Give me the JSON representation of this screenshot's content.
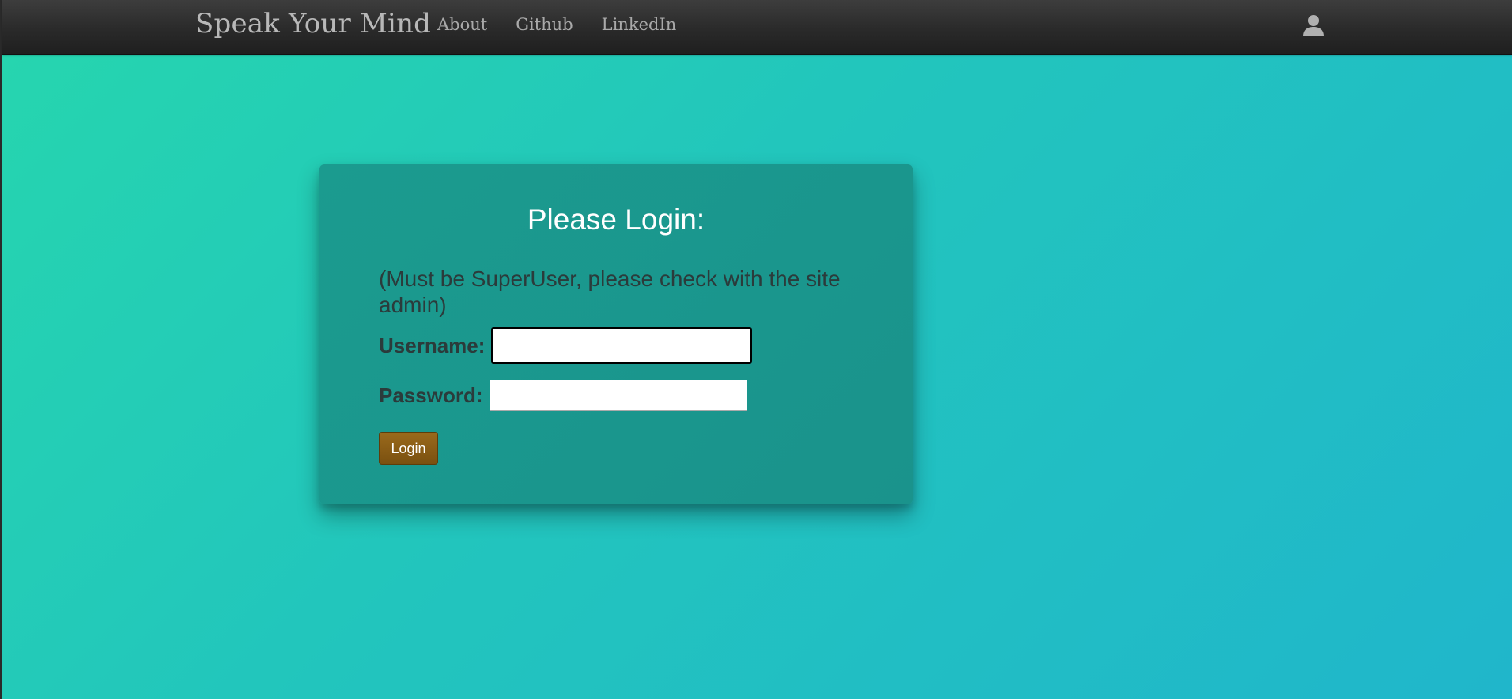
{
  "navbar": {
    "brand": "Speak Your Mind",
    "links": [
      {
        "label": "About"
      },
      {
        "label": "Github"
      },
      {
        "label": "LinkedIn"
      }
    ],
    "user_icon": "user-icon"
  },
  "login": {
    "title": "Please Login:",
    "note": "(Must be SuperUser, please check with the site admin)",
    "username_label": "Username:",
    "username_value": "",
    "password_label": "Password:",
    "password_value": "",
    "submit_label": "Login"
  },
  "colors": {
    "navbar": "#2a2a2a",
    "background_start": "#26d6ae",
    "background_end": "#20b6cb",
    "card": "#1b9b8f",
    "button": "#8a5c15"
  }
}
